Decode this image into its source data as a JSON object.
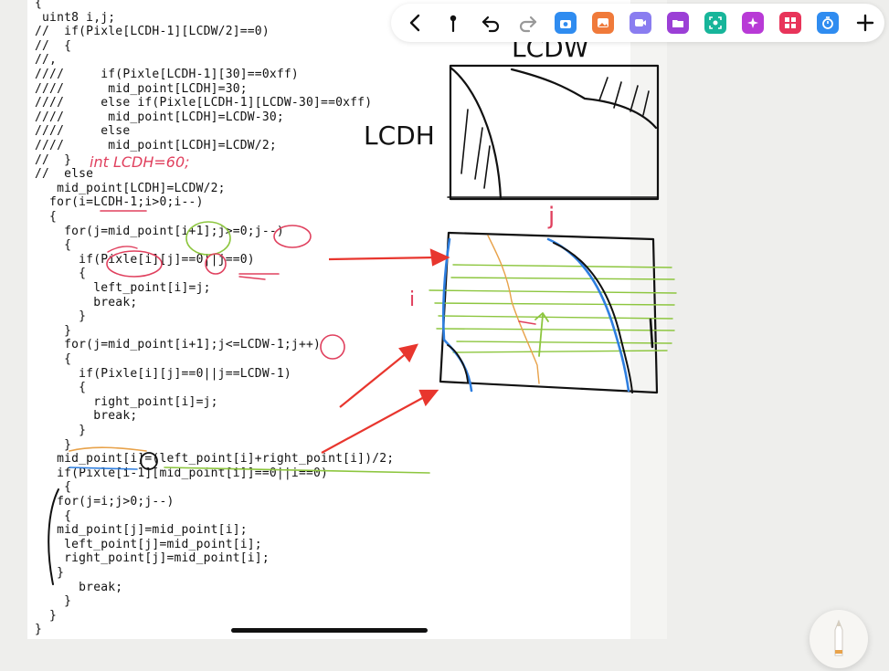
{
  "code": {
    "lines": [
      "{",
      " uint8 i,j;",
      "//  if(Pixle[LCDH-1][LCDW/2]==0)",
      "//  {",
      "//,",
      "////     if(Pixle[LCDH-1][30]==0xff)",
      "////      mid_point[LCDH]=30;",
      "////     else if(Pixle[LCDH-1][LCDW-30]==0xff)",
      "////      mid_point[LCDH]=LCDW-30;",
      "////     else",
      "////      mid_point[LCDH]=LCDW/2;",
      "//  }",
      "//  else",
      "   mid_point[LCDH]=LCDW/2;",
      "  for(i=LCDH-1;i>0;i--)",
      "  {",
      "    for(j=mid_point[i+1];j>=0;j--)",
      "    {",
      "      if(Pixle[i][j]==0||j==0)",
      "      {",
      "        left_point[i]=j;",
      "        break;",
      "      }",
      "    }",
      "    for(j=mid_point[i+1];j<=LCDW-1;j++)",
      "    {",
      "      if(Pixle[i][j]==0||j==LCDW-1)",
      "      {",
      "        right_point[i]=j;",
      "        break;",
      "      }",
      "    }",
      "   mid_point[i]=(left_point[i]+right_point[i])/2;",
      "   if(Pixle[i-1][mid_point[i]]==0||i==0)",
      "    {",
      "   for(j=i;j>0;j--)",
      "    {",
      "   mid_point[j]=mid_point[i];",
      "    left_point[j]=mid_point[i];",
      "    right_point[j]=mid_point[i];",
      "   }",
      "      break;",
      "    }",
      "  }",
      "}"
    ]
  },
  "annotations": {
    "lcdw": "LCDW",
    "lcdh": "LCDH",
    "axis_j": "j",
    "axis_i": "i",
    "int_lcdh": "int LCDH=60;"
  },
  "toolbar": {
    "items": [
      {
        "name": "back-icon",
        "label": "back"
      },
      {
        "name": "pin-icon",
        "label": "pin"
      },
      {
        "name": "undo-icon",
        "label": "undo"
      },
      {
        "name": "redo-icon",
        "label": "redo"
      },
      {
        "name": "camera-app-icon",
        "label": "camera",
        "color": "#2f8cf0"
      },
      {
        "name": "image-app-icon",
        "label": "image",
        "color": "#f07a3a"
      },
      {
        "name": "video-app-icon",
        "label": "video",
        "color": "#8a7df0"
      },
      {
        "name": "folder-app-icon",
        "label": "folder",
        "color": "#9b3fd6"
      },
      {
        "name": "scan-app-icon",
        "label": "scan",
        "color": "#17b59a"
      },
      {
        "name": "magic-app-icon",
        "label": "magic",
        "color": "#b83ad6"
      },
      {
        "name": "grid-app-icon",
        "label": "grid",
        "color": "#e8345a"
      },
      {
        "name": "timer-app-icon",
        "label": "timer",
        "color": "#2f8cf0"
      },
      {
        "name": "add-icon",
        "label": "add"
      }
    ]
  },
  "colors": {
    "ink": "#111111",
    "red_ink": "#e0405e",
    "arrow_red": "#e8362e",
    "green_ink": "#8dc63f",
    "blue_ink": "#2f7fe0",
    "orange_ink": "#e8a24a"
  }
}
